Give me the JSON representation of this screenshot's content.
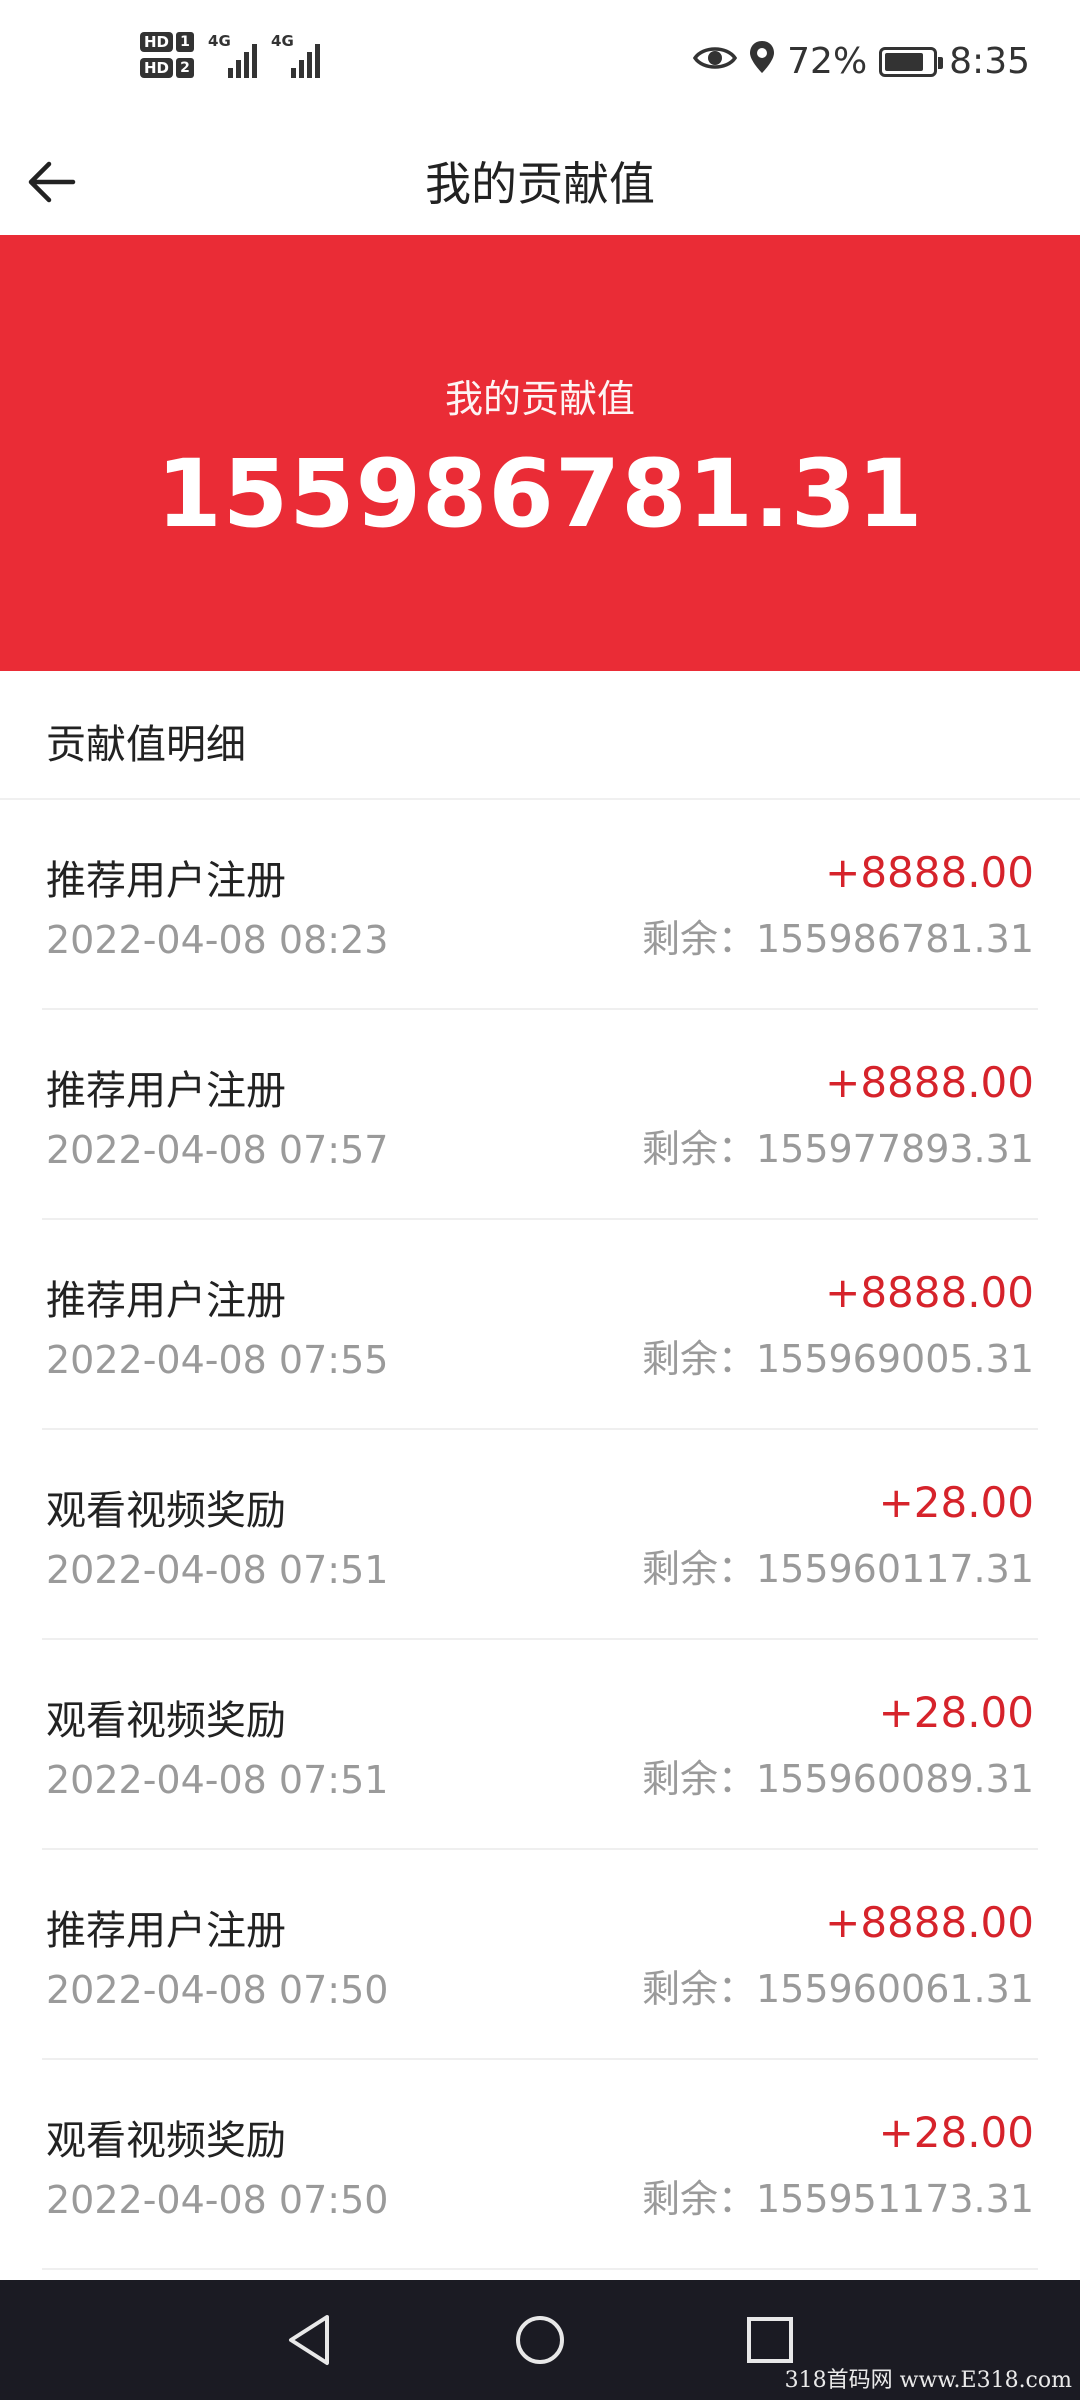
{
  "status_bar": {
    "sim1": "HD",
    "sim1_num": "1",
    "sim2": "HD",
    "sim2_num": "2",
    "net1": "4G",
    "net2": "4G",
    "battery_percent": "72%",
    "battery_level": 0.72,
    "time": "8:35",
    "icons": [
      "eye-icon",
      "location-icon",
      "battery-icon"
    ]
  },
  "header": {
    "title": "我的贡献值",
    "back_icon": "arrow-left-icon"
  },
  "banner": {
    "label": "我的贡献值",
    "value": "155986781.31",
    "color": "#ea2c36"
  },
  "section": {
    "title": "贡献值明细"
  },
  "records": [
    {
      "title": "推荐用户注册",
      "time": "2022-04-08 08:23",
      "amount": "+8888.00",
      "balance": "剩余：155986781.31"
    },
    {
      "title": "推荐用户注册",
      "time": "2022-04-08 07:57",
      "amount": "+8888.00",
      "balance": "剩余：155977893.31"
    },
    {
      "title": "推荐用户注册",
      "time": "2022-04-08 07:55",
      "amount": "+8888.00",
      "balance": "剩余：155969005.31"
    },
    {
      "title": "观看视频奖励",
      "time": "2022-04-08 07:51",
      "amount": "+28.00",
      "balance": "剩余：155960117.31"
    },
    {
      "title": "观看视频奖励",
      "time": "2022-04-08 07:51",
      "amount": "+28.00",
      "balance": "剩余：155960089.31"
    },
    {
      "title": "推荐用户注册",
      "time": "2022-04-08 07:50",
      "amount": "+8888.00",
      "balance": "剩余：155960061.31"
    },
    {
      "title": "观看视频奖励",
      "time": "2022-04-08 07:50",
      "amount": "+28.00",
      "balance": "剩余：155951173.31"
    }
  ],
  "nav_bar": {
    "icons": [
      "nav-back-icon",
      "nav-home-icon",
      "nav-recents-icon"
    ]
  },
  "watermark": "318首码网 www.E318.com"
}
